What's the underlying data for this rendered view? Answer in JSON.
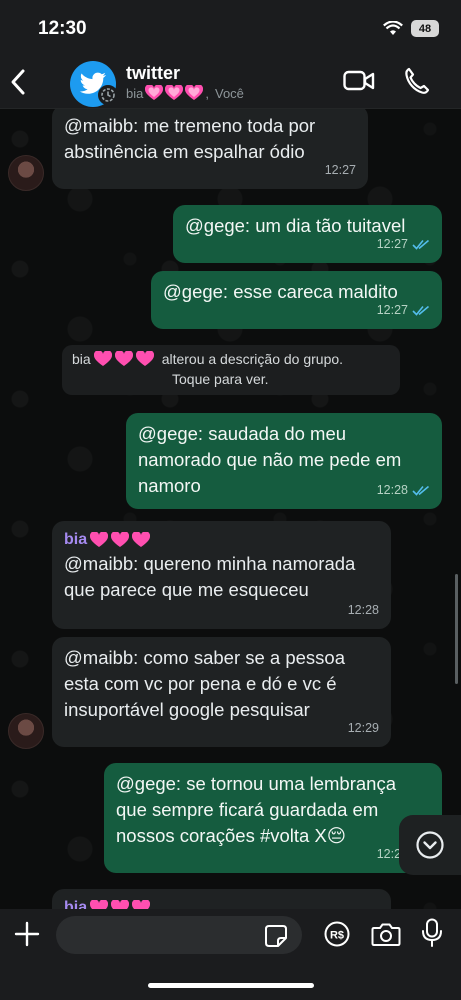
{
  "status_bar": {
    "time": "12:30",
    "battery": "48"
  },
  "header": {
    "title": "twitter",
    "subtitle_name": "bia",
    "subtitle_sep": ",",
    "subtitle_you": "Você"
  },
  "system_message": {
    "name": "bia",
    "line1": "alterou a descrição do grupo.",
    "line2": "Toque para ver."
  },
  "messages": [
    {
      "dir": "in",
      "lines": [
        "@maibb: me tremeno toda por",
        "abstinência em espalhar ódio"
      ],
      "time": "12:27"
    },
    {
      "dir": "out",
      "lines": [
        "@gege: um dia tão tuitavel"
      ],
      "time": "12:27"
    },
    {
      "dir": "out",
      "lines": [
        "@gege: esse careca maldito"
      ],
      "time": "12:27"
    },
    {
      "dir": "out",
      "lines": [
        "@gege: saudada do meu",
        "namorado que não me pede em",
        "namoro"
      ],
      "time": "12:28"
    },
    {
      "dir": "in",
      "sender": "bia",
      "lines": [
        "@maibb: quereno minha namorada",
        "que parece que me esqueceu"
      ],
      "time": "12:28"
    },
    {
      "dir": "in",
      "lines": [
        "@maibb: como saber se a pessoa",
        "esta com vc por pena e dó e vc é",
        "insuportável google pesquisar"
      ],
      "time": "12:29"
    },
    {
      "dir": "out",
      "lines": [
        "@gege: se tornou uma lembrança",
        "que sempre ficará guardada em",
        "nossos corações #volta X😔"
      ],
      "time": "12:29"
    },
    {
      "dir": "in",
      "sender": "bia",
      "lines": [],
      "time": ""
    }
  ],
  "input": {
    "placeholder": "",
    "value": ""
  },
  "colors": {
    "outgoing": "#155c3f",
    "incoming": "#1f2223",
    "sender": "#a58af0",
    "read_ticks": "#53bdeb",
    "heart": "#ff4fb0"
  },
  "icons": [
    "back-icon",
    "twitter-bird-icon",
    "group-timer-icon",
    "video-call-icon",
    "phone-icon",
    "double-check-icon",
    "scroll-down-icon",
    "plus-icon",
    "sticker-icon",
    "pix-payment-icon",
    "camera-icon",
    "microphone-icon"
  ]
}
